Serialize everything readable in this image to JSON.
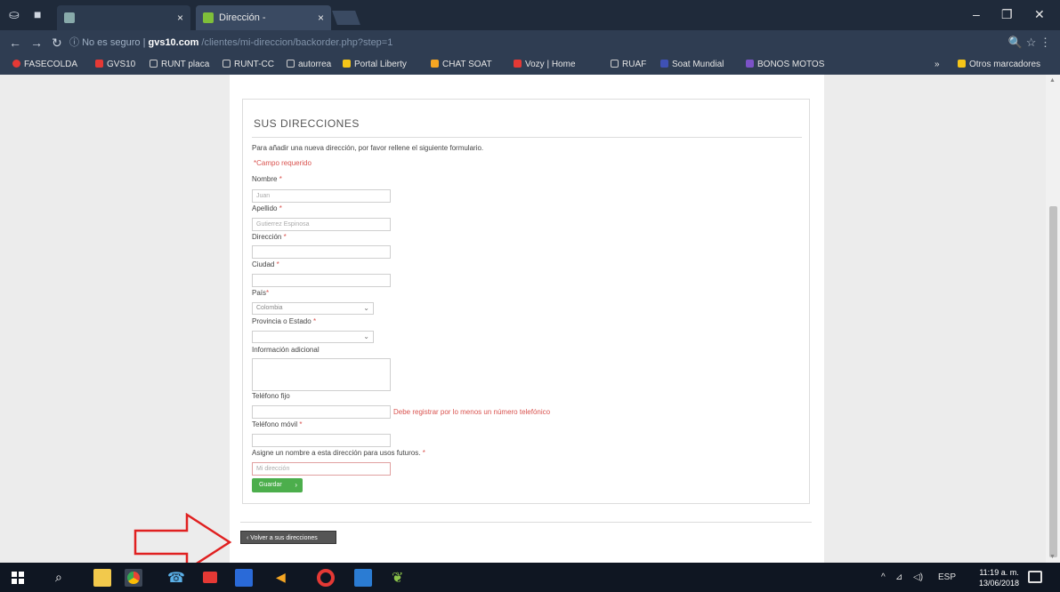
{
  "browser": {
    "tabs": [
      {
        "label": "",
        "active": false
      },
      {
        "label": "Dirección -",
        "active": true
      }
    ],
    "url": {
      "info_label": "No es seguro",
      "domain": "gvs10.com",
      "path": "/clientes/mi-direccion/backorder.php?step=1"
    },
    "bookmarks": [
      {
        "label": "FASECOLDA",
        "color": "#e53935"
      },
      {
        "label": "GVS10",
        "color": "#e53935"
      },
      {
        "label": "RUNT placa",
        "color": "#cccccc"
      },
      {
        "label": "RUNT-CC",
        "color": "#cccccc"
      },
      {
        "label": "autorrea",
        "color": "#cccccc"
      },
      {
        "label": "Portal Liberty",
        "color": "#f5c518"
      },
      {
        "label": "CHAT SOAT",
        "color": "#f5a623"
      },
      {
        "label": "Vozy | Home",
        "color": "#e53935"
      },
      {
        "label": "RUAF",
        "color": "#cccccc"
      },
      {
        "label": "Soat Mundial",
        "color": "#3f51b5"
      },
      {
        "label": "BONOS MOTOS",
        "color": "#7b52c7"
      }
    ],
    "other_bookmarks": "Otros marcadores"
  },
  "form": {
    "title": "SUS DIRECCIONES",
    "intro": "Para añadir una nueva dirección, por favor rellene el siguiente formulario.",
    "required_note": "*Campo requerido",
    "fields": {
      "nombre": {
        "label": "Nombre",
        "value": "Juan"
      },
      "apellido": {
        "label": "Apellido",
        "value": "Gutierrez Espinosa"
      },
      "direccion": {
        "label": "Dirección",
        "value": ""
      },
      "ciudad": {
        "label": "Ciudad",
        "value": ""
      },
      "pais": {
        "label": "País",
        "value": "Colombia"
      },
      "provincia": {
        "label": "Provincia o Estado",
        "value": ""
      },
      "info_adicional": {
        "label": "Información adicional"
      },
      "telefono_fijo": {
        "label": "Teléfono fijo",
        "value": ""
      },
      "telefono_fijo_error": "Debe registrar por lo menos un número telefónico",
      "telefono_movil": {
        "label": "Teléfono móvil",
        "value": ""
      },
      "alias": {
        "label": "Asigne un nombre a esta dirección para usos futuros.",
        "placeholder": "Mi dirección"
      }
    },
    "required_mark": "*",
    "save_label": "Guardar",
    "back_label": "Volver a sus direcciones"
  },
  "taskbar": {
    "language": "ESP",
    "time": "11:19 a. m.",
    "date": "13/06/2018"
  },
  "colors": {
    "accent_green": "#4cae4c",
    "error_red": "#d9534f",
    "annotation_red": "#e02020"
  }
}
